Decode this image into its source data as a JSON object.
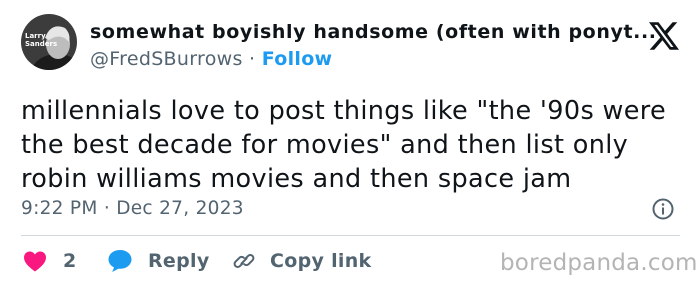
{
  "user": {
    "display_name": "somewhat boyishly handsome (often with ponyt...",
    "handle": "@FredSBurrows",
    "separator": " · ",
    "follow_label": "Follow",
    "avatar_text": [
      "Larry",
      "Sanders"
    ]
  },
  "tweet": {
    "text": "millennials love to post things like \"the '90s were the best decade for movies\" and then list only robin williams movies and then space jam",
    "time": "9:22 PM",
    "date_separator": " · ",
    "date": "Dec 27, 2023"
  },
  "actions": {
    "like_count": "2",
    "reply_label": "Reply",
    "copy_link_label": "Copy link"
  },
  "watermark": "boredpanda.com",
  "icons": {
    "logo": "x-logo-icon",
    "info": "info-icon",
    "like": "heart-icon",
    "reply": "speech-bubble-icon",
    "copy_link": "link-icon"
  },
  "colors": {
    "accent": "#1d9bf0",
    "heart": "#f91880",
    "secondary_text": "#536471",
    "divider": "#cfd9de"
  }
}
